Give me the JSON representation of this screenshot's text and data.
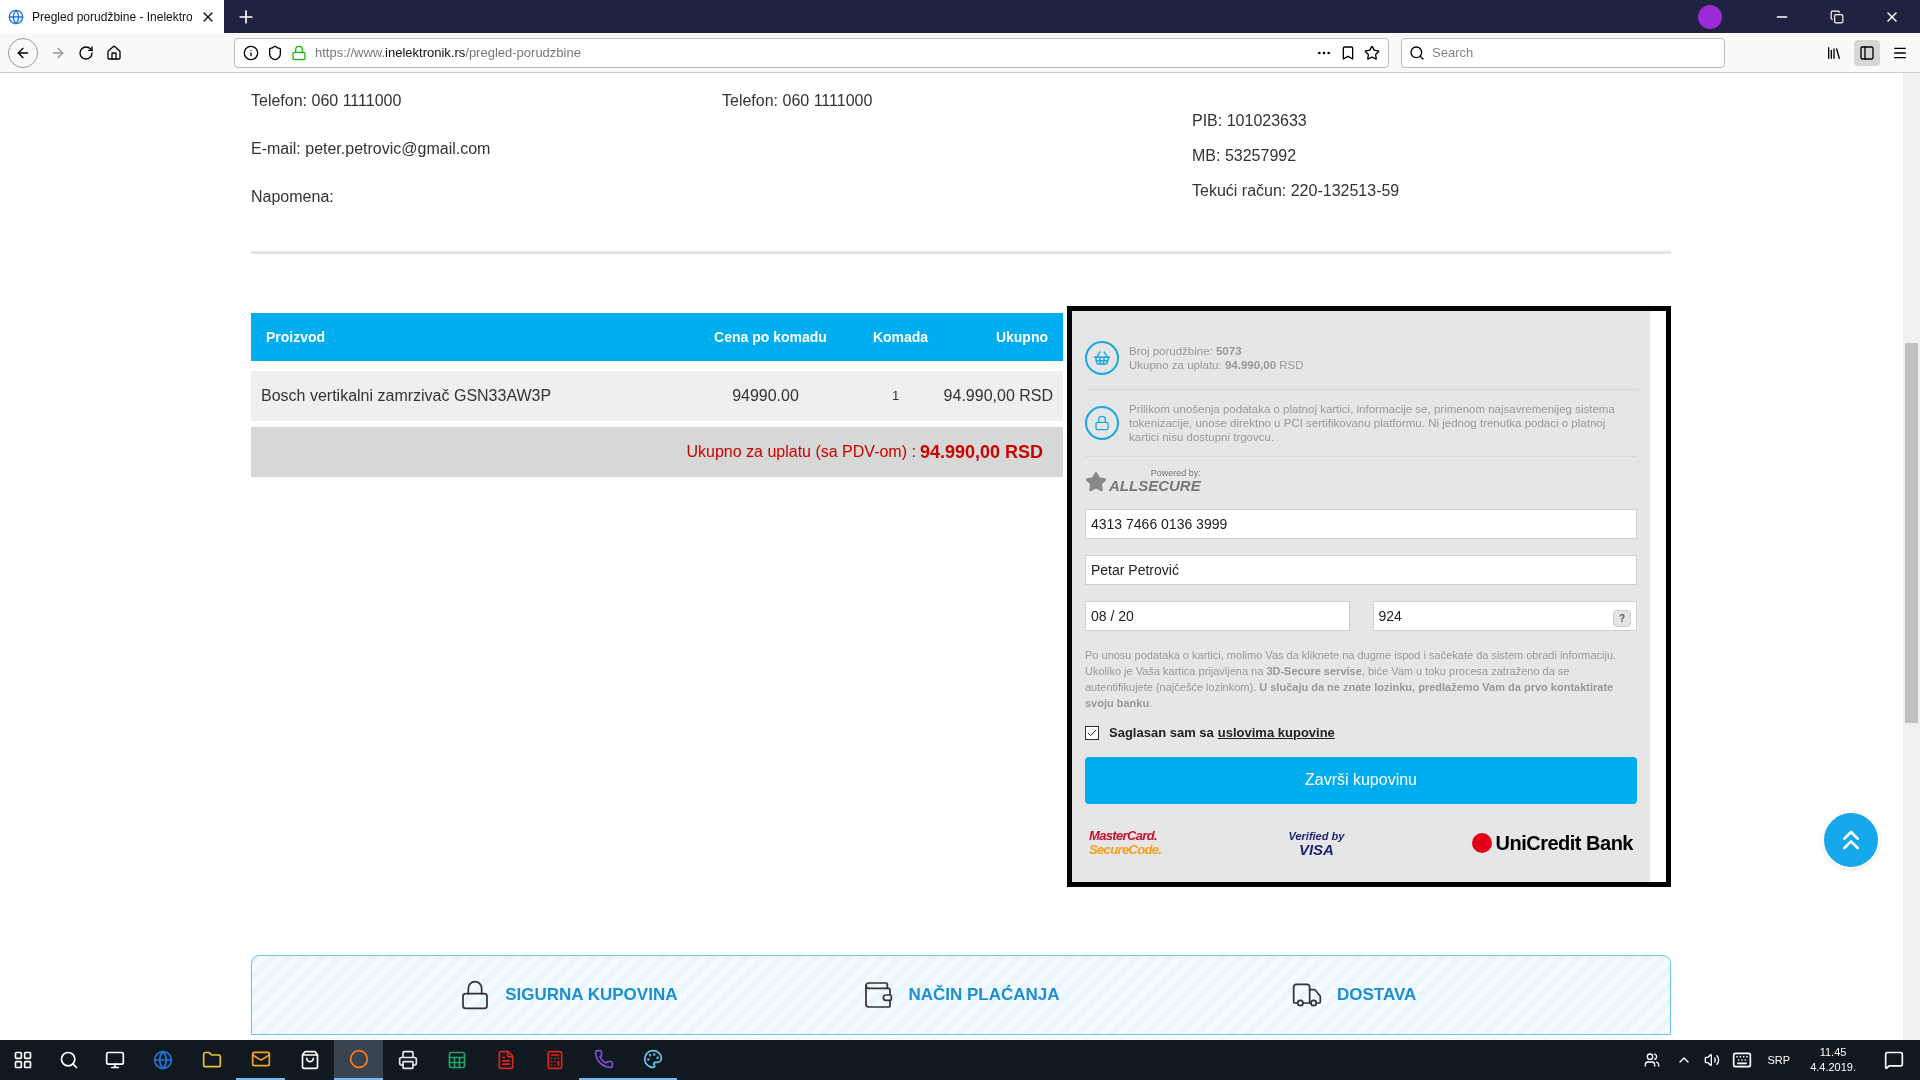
{
  "browser": {
    "tab_title": "Pregled porudžbine - Inelektro",
    "url_prefix": "https://www.",
    "url_domain": "inelektronik.rs",
    "url_path": "/pregled-porudzbine",
    "search_placeholder": "Search"
  },
  "customer": [
    "Telefon: 060 1111000",
    "E-mail: peter.petrovic@gmail.com",
    "Napomena:"
  ],
  "recipient": [
    "Telefon: 060 1111000"
  ],
  "seller": [
    "PIB: 101023633",
    "MB: 53257992",
    "Tekući račun: 220-132513-59"
  ],
  "table": {
    "columns": [
      "Proizvod",
      "Cena po komadu",
      "Komada",
      "Ukupno"
    ],
    "rows": [
      [
        "Bosch vertikalni zamrzivač GSN33AW3P",
        "94990.00",
        "1",
        "94.990,00 RSD"
      ]
    ],
    "total_label": "Ukupno za uplatu (sa PDV-om) :",
    "total_value": "94.990,00 RSD"
  },
  "payment": {
    "order_info": "Broj porudžbine: **5073**",
    "amount_info": "Ukupno za uplatu: **94.990,00** RSD",
    "security_note": "Prilikom unošenja podataka o platnoj kartici, informacije se, primenom najsavremenijeg sistema tokenizacije, unose direktno u PCI sertifikovanu platformu. Ni jednog trenutka podaci o platnoj kartici nisu dostupni trgovcu.",
    "powered_by": "Powered by:",
    "provider": "ALLSECURE",
    "card_number": "4313 7466 0136 3999",
    "card_holder": "Petar Petrović",
    "expiry": "08 / 20",
    "cvv": "924",
    "cvv_help": "?",
    "instructions": "Po unosu podataka o kartici, molimo Vas da kliknete na dugme ispod i sačekate da sistem obradi informaciju. Ukoliko je Vaša kartica prijavljena na **3D-Secure servise**, biće Vam u toku procesa zatraženo da se autentifikujete (najčešće lozinkom). **U slučaju da ne znate lozinku, predlažemo Vam da prvo kontaktirate svoju banku**.",
    "agree": {
      "checked": true,
      "text": "Saglasan sam sa",
      "link": "uslovima kupovine"
    },
    "submit": "Završi kupovinu",
    "logos": {
      "mastercard_1": "MasterCard.",
      "mastercard_2": "SecureCode.",
      "visa_1": "Verified by",
      "visa_2": "VISA",
      "bank": "UniCredit Bank"
    }
  },
  "features": [
    "SIGURNA KUPOVINA",
    "NAČIN PLAĆANJA",
    "DOSTAVA"
  ],
  "taskbar": {
    "apps": [
      {
        "selected": false,
        "running": false
      },
      {
        "selected": false,
        "running": false
      },
      {
        "selected": false,
        "running": true
      },
      {
        "selected": false,
        "running": false
      },
      {
        "selected": true,
        "running": true
      },
      {
        "selected": false,
        "running": false
      },
      {
        "selected": false,
        "running": false
      },
      {
        "selected": false,
        "running": false
      },
      {
        "selected": false,
        "running": false
      },
      {
        "selected": false,
        "running": true
      },
      {
        "selected": false,
        "running": true
      }
    ],
    "language": "SRP",
    "time": "11.45",
    "date": "4.4.2019."
  }
}
